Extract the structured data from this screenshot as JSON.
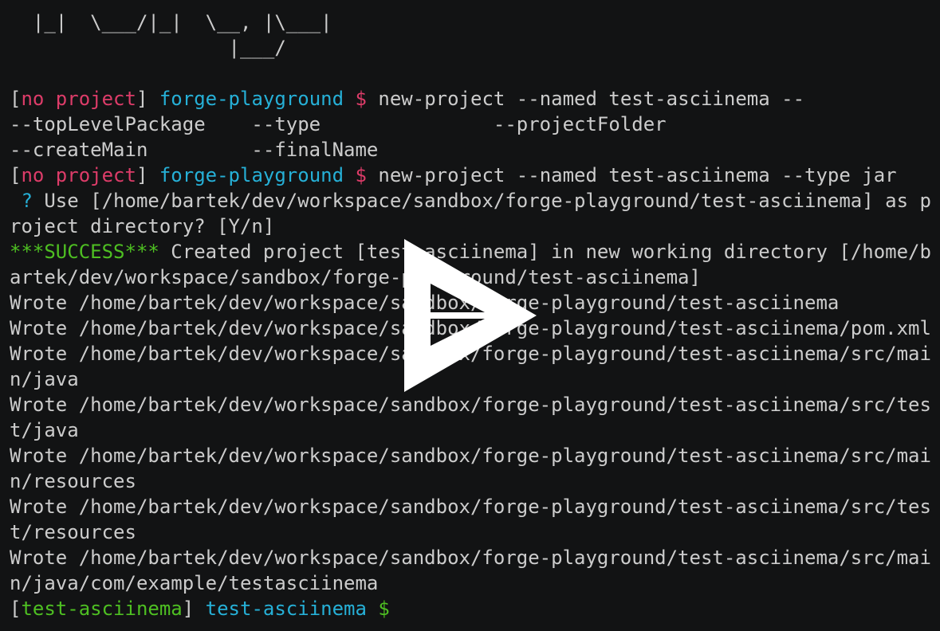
{
  "lines": [
    [
      {
        "t": "  |_|  \\___/|_|  \\__, |\\___|",
        "c": "default"
      }
    ],
    [
      {
        "t": "                   |___/",
        "c": "default"
      }
    ],
    [
      {
        "t": "",
        "c": "default"
      }
    ],
    [
      {
        "t": "[",
        "c": "default"
      },
      {
        "t": "no project",
        "c": "red"
      },
      {
        "t": "] ",
        "c": "default"
      },
      {
        "t": "forge-playground",
        "c": "cyan"
      },
      {
        "t": " $",
        "c": "red"
      },
      {
        "t": " new-project --named test-asciinema --",
        "c": "default"
      }
    ],
    [
      {
        "t": "--topLevelPackage    --type               --projectFolder",
        "c": "default"
      }
    ],
    [
      {
        "t": "--createMain         --finalName",
        "c": "default"
      }
    ],
    [
      {
        "t": "[",
        "c": "default"
      },
      {
        "t": "no project",
        "c": "red"
      },
      {
        "t": "] ",
        "c": "default"
      },
      {
        "t": "forge-playground",
        "c": "cyan"
      },
      {
        "t": " $",
        "c": "red"
      },
      {
        "t": " new-project --named test-asciinema --type jar",
        "c": "default"
      }
    ],
    [
      {
        "t": " ?",
        "c": "cyan"
      },
      {
        "t": " Use [/home/bartek/dev/workspace/sandbox/forge-playground/test-asciinema] as p",
        "c": "default"
      }
    ],
    [
      {
        "t": "roject directory? [Y/n]",
        "c": "default"
      }
    ],
    [
      {
        "t": "***SUCCESS***",
        "c": "green"
      },
      {
        "t": " Created project [test-asciinema] in new working directory [/home/b",
        "c": "default"
      }
    ],
    [
      {
        "t": "artek/dev/workspace/sandbox/forge-playground/test-asciinema]",
        "c": "default"
      }
    ],
    [
      {
        "t": "Wrote /home/bartek/dev/workspace/sandbox/forge-playground/test-asciinema",
        "c": "default"
      }
    ],
    [
      {
        "t": "Wrote /home/bartek/dev/workspace/sandbox/forge-playground/test-asciinema/pom.xml",
        "c": "default"
      }
    ],
    [
      {
        "t": "Wrote /home/bartek/dev/workspace/sandbox/forge-playground/test-asciinema/src/mai",
        "c": "default"
      }
    ],
    [
      {
        "t": "n/java",
        "c": "default"
      }
    ],
    [
      {
        "t": "Wrote /home/bartek/dev/workspace/sandbox/forge-playground/test-asciinema/src/tes",
        "c": "default"
      }
    ],
    [
      {
        "t": "t/java",
        "c": "default"
      }
    ],
    [
      {
        "t": "Wrote /home/bartek/dev/workspace/sandbox/forge-playground/test-asciinema/src/mai",
        "c": "default"
      }
    ],
    [
      {
        "t": "n/resources",
        "c": "default"
      }
    ],
    [
      {
        "t": "Wrote /home/bartek/dev/workspace/sandbox/forge-playground/test-asciinema/src/tes",
        "c": "default"
      }
    ],
    [
      {
        "t": "t/resources",
        "c": "default"
      }
    ],
    [
      {
        "t": "Wrote /home/bartek/dev/workspace/sandbox/forge-playground/test-asciinema/src/mai",
        "c": "default"
      }
    ],
    [
      {
        "t": "n/java/com/example/testasciinema",
        "c": "default"
      }
    ],
    [
      {
        "t": "[",
        "c": "default"
      },
      {
        "t": "test-asciinema",
        "c": "green"
      },
      {
        "t": "] ",
        "c": "default"
      },
      {
        "t": "test-asciinema",
        "c": "cyan"
      },
      {
        "t": " $",
        "c": "green"
      }
    ]
  ],
  "colors": {
    "background": "#121314",
    "default": "#cccccc",
    "red": "#dd3c69",
    "cyan": "#26b0d7",
    "green": "#4ebf22",
    "play_icon": "#ffffff"
  },
  "overlay": {
    "icon": "play-icon"
  }
}
